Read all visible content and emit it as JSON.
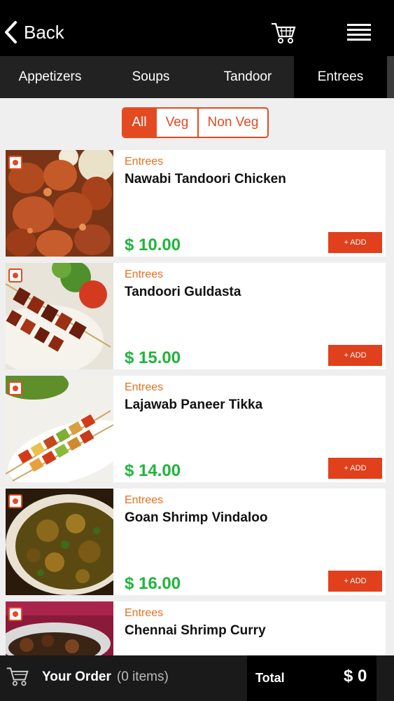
{
  "header": {
    "back_label": "Back"
  },
  "tabs": [
    {
      "label": "Appetizers"
    },
    {
      "label": "Soups"
    },
    {
      "label": "Tandoor"
    },
    {
      "label": "Entrees"
    }
  ],
  "filters": {
    "all": "All",
    "veg": "Veg",
    "nonveg": "Non Veg"
  },
  "items": [
    {
      "category": "Entrees",
      "name": "Nawabi Tandoori Chicken",
      "price": "$ 10.00",
      "add": "+ ADD"
    },
    {
      "category": "Entrees",
      "name": "Tandoori Guldasta",
      "price": "$ 15.00",
      "add": "+ ADD"
    },
    {
      "category": "Entrees",
      "name": "Lajawab Paneer Tikka",
      "price": "$ 14.00",
      "add": "+ ADD"
    },
    {
      "category": "Entrees",
      "name": "Goan Shrimp Vindaloo",
      "price": "$ 16.00",
      "add": "+ ADD"
    },
    {
      "category": "Entrees",
      "name": "Chennai Shrimp Curry"
    }
  ],
  "footer": {
    "your_order": "Your Order",
    "item_count": "(0 items)",
    "total_label": "Total",
    "total_value": "$ 0"
  },
  "colors": {
    "accent": "#e34a22",
    "price": "#1fb53a",
    "category": "#e8701e"
  }
}
